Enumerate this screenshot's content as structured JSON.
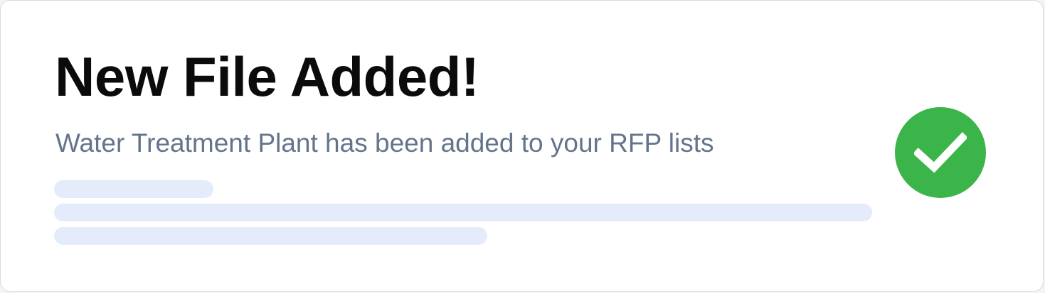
{
  "notification": {
    "title": "New File Added!",
    "message": "Water Treatment Plant has been added to your RFP lists",
    "status_icon": "check-circle-icon",
    "colors": {
      "success": "#3bb54a",
      "title": "#0b0b0b",
      "message": "#64748b",
      "placeholder": "#e4ecfb"
    }
  }
}
